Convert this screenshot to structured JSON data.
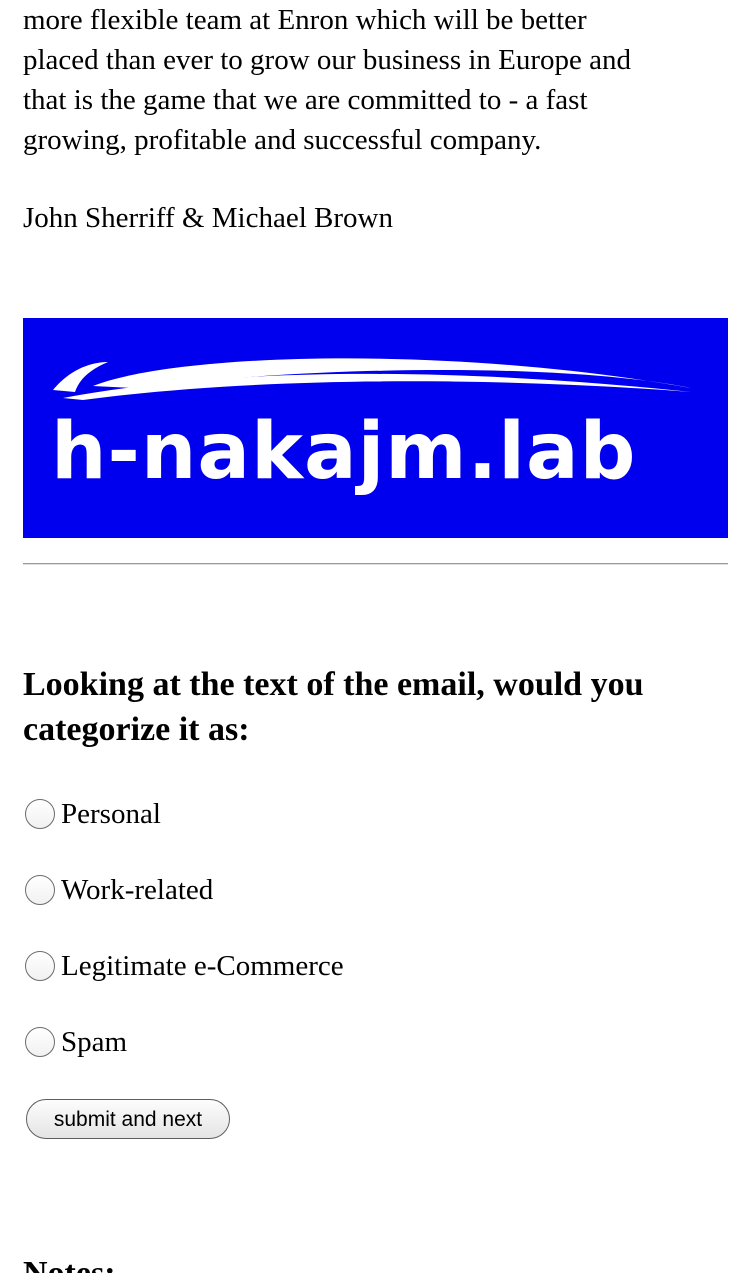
{
  "email": {
    "lines": [
      "more flexible team at Enron which will be better",
      "placed than ever to grow our business in Europe and",
      "that is the game that we are committed to - a fast",
      "growing, profitable and successful company."
    ],
    "signature": "John Sherriff & Michael Brown"
  },
  "banner": {
    "text": "h-nakajm.lab",
    "background_color": "#0000ee",
    "text_color": "#ffffff"
  },
  "survey": {
    "question": "Looking at the text of the email, would you categorize it as:",
    "options": [
      {
        "label": "Personal",
        "selected": false
      },
      {
        "label": "Work-related",
        "selected": false
      },
      {
        "label": "Legitimate e-Commerce",
        "selected": false
      },
      {
        "label": "Spam",
        "selected": false
      }
    ],
    "submit_label": "submit and next"
  },
  "notes": {
    "heading": "Notes:"
  }
}
